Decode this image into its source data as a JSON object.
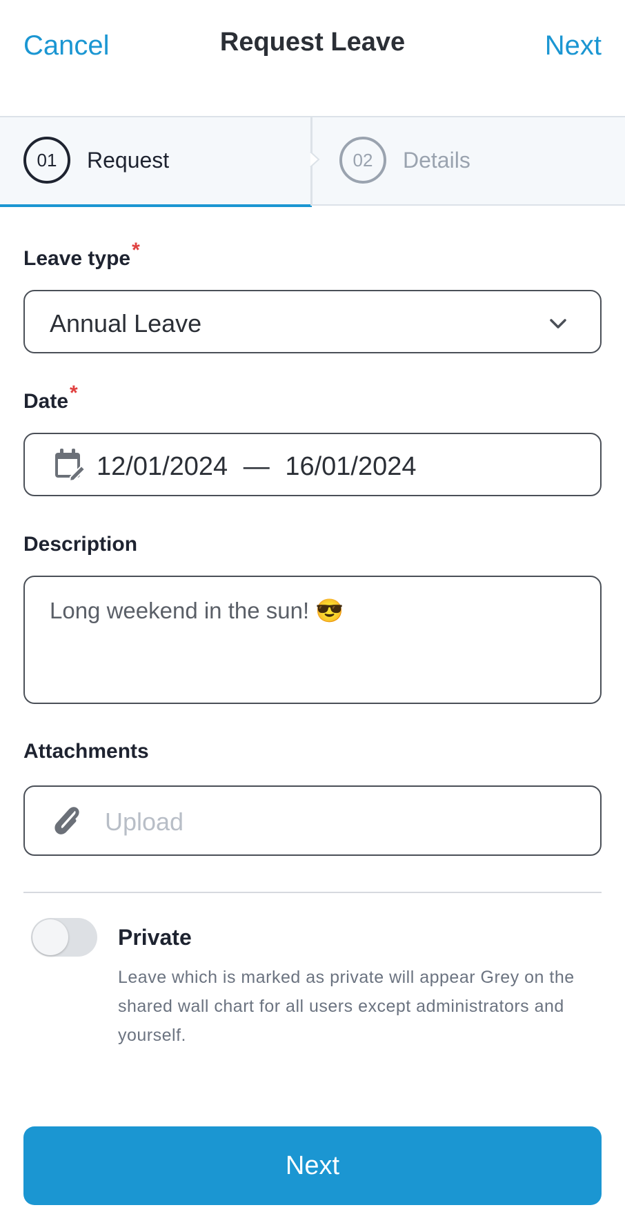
{
  "header": {
    "cancel_label": "Cancel",
    "title": "Request Leave",
    "next_label": "Next"
  },
  "stepper": {
    "steps": [
      {
        "number": "01",
        "label": "Request",
        "active": true
      },
      {
        "number": "02",
        "label": "Details",
        "active": false
      }
    ]
  },
  "form": {
    "leave_type": {
      "label": "Leave type",
      "required_mark": "*",
      "value": "Annual Leave"
    },
    "date": {
      "label": "Date",
      "required_mark": "*",
      "start": "12/01/2024",
      "separator": "—",
      "end": "16/01/2024"
    },
    "description": {
      "label": "Description",
      "value": "Long weekend in the sun!  😎"
    },
    "attachments": {
      "label": "Attachments",
      "placeholder": "Upload"
    },
    "private": {
      "title": "Private",
      "on": false,
      "description": "Leave which is marked as private will appear Grey on the shared wall chart for all users except administrators and yourself."
    }
  },
  "footer": {
    "next_button_label": "Next"
  },
  "colors": {
    "accent": "#1b96d2",
    "required": "#e0403f",
    "text": "#1e2330",
    "muted": "#9aa3af"
  },
  "icons": {
    "date": "calendar-edit-icon",
    "select": "chevron-down-icon",
    "attach": "paperclip-icon"
  }
}
